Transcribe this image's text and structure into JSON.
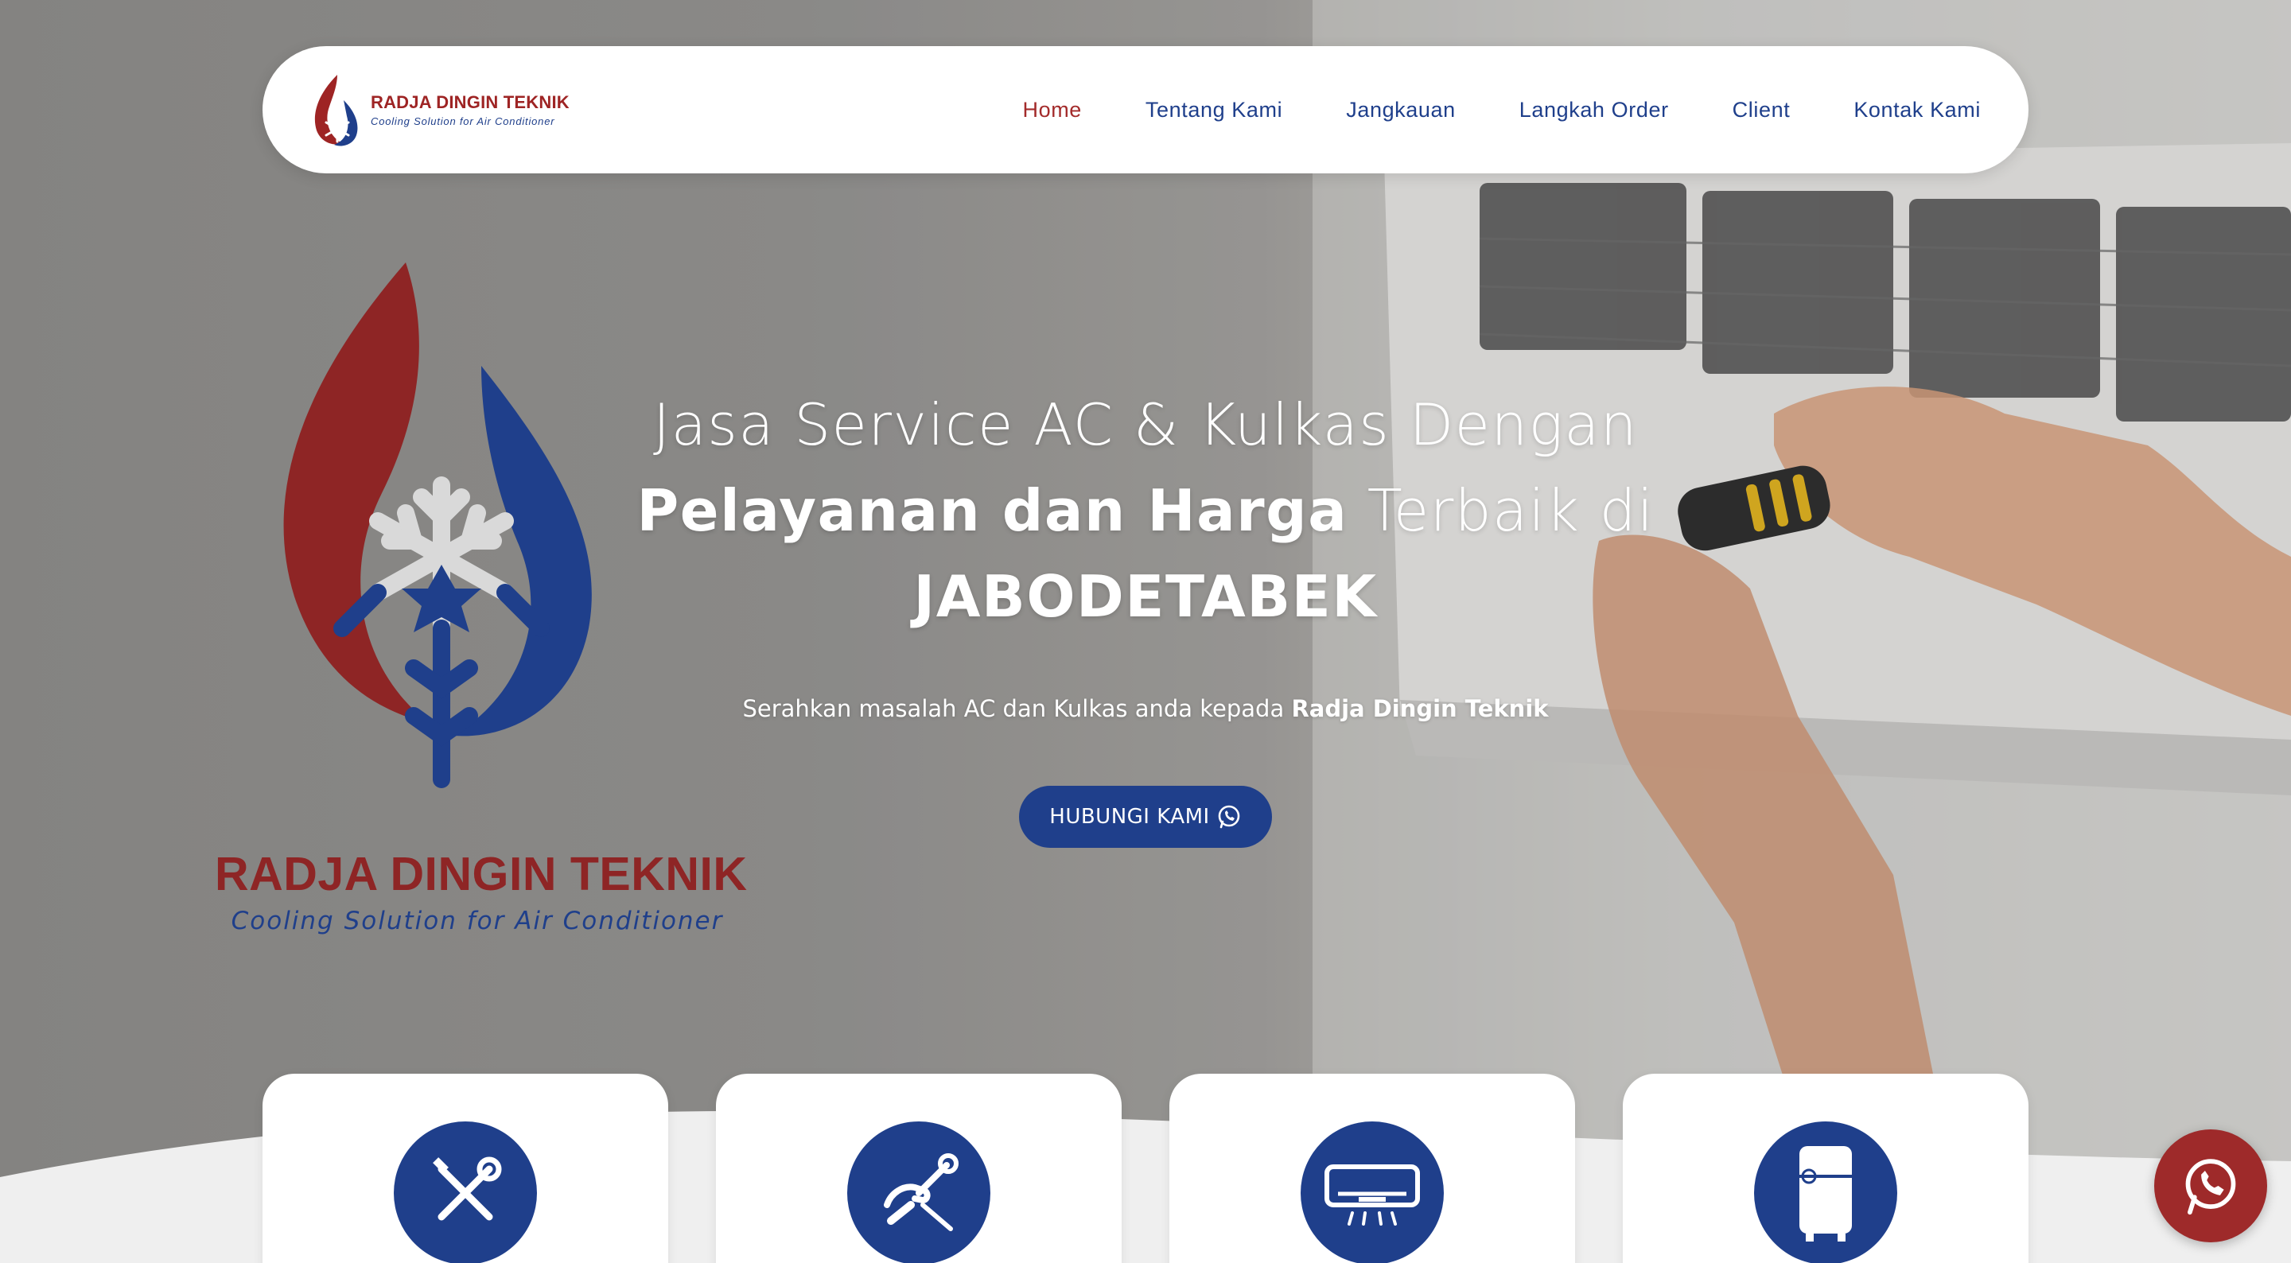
{
  "brand": {
    "name": "RADJA DINGIN TEKNIK",
    "tagline": "Cooling Solution for Air Conditioner"
  },
  "nav": {
    "items": [
      {
        "label": "Home",
        "active": true
      },
      {
        "label": "Tentang Kami",
        "active": false
      },
      {
        "label": "Jangkauan",
        "active": false
      },
      {
        "label": "Langkah Order",
        "active": false
      },
      {
        "label": "Client",
        "active": false
      },
      {
        "label": "Kontak Kami",
        "active": false
      }
    ]
  },
  "hero": {
    "headline_part1": "Jasa Service AC & Kulkas Dengan",
    "headline_bold1": "Pelayanan dan Harga",
    "headline_part2": "Terbaik di",
    "headline_bold2": "JABODETABEK",
    "sub_text": "Serahkan masalah AC dan Kulkas anda kepada",
    "sub_bold": "Radja Dingin Teknik",
    "cta_label": "HUBUNGI KAMI"
  },
  "services": [
    {
      "icon": "tools-icon"
    },
    {
      "icon": "repair-hand-icon"
    },
    {
      "icon": "air-conditioner-icon"
    },
    {
      "icon": "refrigerator-icon"
    }
  ],
  "colors": {
    "brand_blue": "#1f3f8b",
    "brand_red": "#9e2424",
    "nav_active": "#a32b2b",
    "white": "#ffffff"
  },
  "icons": {
    "cta": "whatsapp-icon",
    "floating": "whatsapp-icon"
  }
}
